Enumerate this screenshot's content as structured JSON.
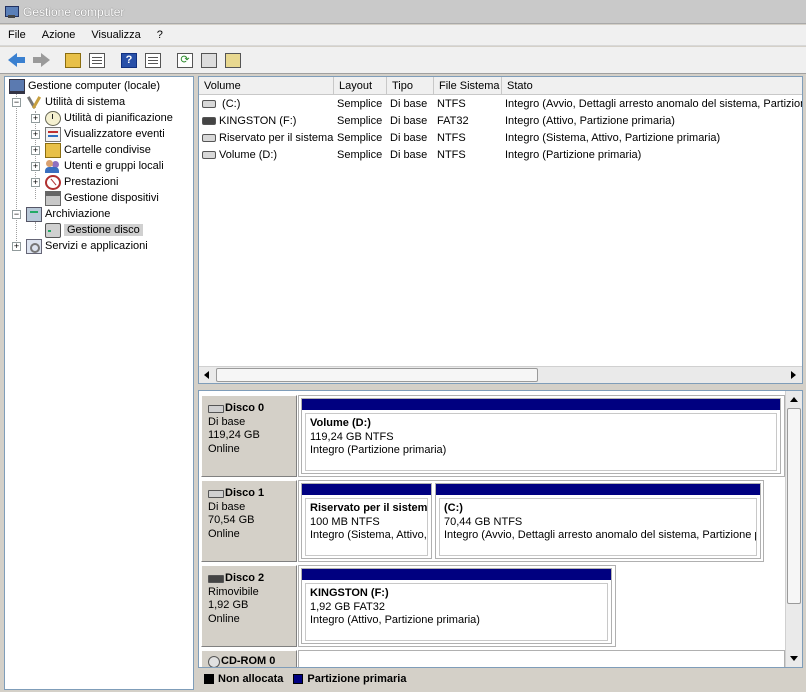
{
  "window": {
    "title": "Gestione computer"
  },
  "menu": [
    "File",
    "Azione",
    "Visualizza",
    "?"
  ],
  "tree": {
    "root": "Gestione computer (locale)",
    "system_tools": "Utilità di sistema",
    "task_scheduler": "Utilità di pianificazione",
    "event_viewer": "Visualizzatore eventi",
    "shared_folders": "Cartelle condivise",
    "local_users": "Utenti e gruppi locali",
    "performance": "Prestazioni",
    "device_manager": "Gestione dispositivi",
    "storage": "Archiviazione",
    "disk_management": "Gestione disco",
    "services_apps": "Servizi e applicazioni"
  },
  "volume_list": {
    "columns": [
      "Volume",
      "Layout",
      "Tipo",
      "File Sistema",
      "Stato"
    ],
    "rows": [
      {
        "volume": " (C:)",
        "layout": "Semplice",
        "tipo": "Di base",
        "fs": "NTFS",
        "stato": "Integro (Avvio, Dettagli arresto anomalo del sistema, Partizione primaria)",
        "icon": "drive-icon"
      },
      {
        "volume": "KINGSTON (F:)",
        "layout": "Semplice",
        "tipo": "Di base",
        "fs": "FAT32",
        "stato": "Integro (Attivo, Partizione primaria)",
        "icon": "usb-drive-icon"
      },
      {
        "volume": "Riservato per il sistema",
        "layout": "Semplice",
        "tipo": "Di base",
        "fs": "NTFS",
        "stato": "Integro (Sistema, Attivo, Partizione primaria)",
        "icon": "drive-icon"
      },
      {
        "volume": "Volume (D:)",
        "layout": "Semplice",
        "tipo": "Di base",
        "fs": "NTFS",
        "stato": "Integro (Partizione primaria)",
        "icon": "drive-icon"
      }
    ]
  },
  "disks": [
    {
      "name": "Disco 0",
      "type": "Di base",
      "size": "119,24 GB",
      "status": "Online",
      "partitions": [
        {
          "name": "Volume  (D:)",
          "size": "119,24 GB NTFS",
          "status": "Integro (Partizione primaria)"
        }
      ]
    },
    {
      "name": "Disco 1",
      "type": "Di base",
      "size": "70,54 GB",
      "status": "Online",
      "partitions": [
        {
          "name": "Riservato per il sistema",
          "size": "100 MB NTFS",
          "status": "Integro (Sistema, Attivo, Partizione primaria)"
        },
        {
          "name": "  (C:)",
          "size": "70,44 GB NTFS",
          "status": "Integro (Avvio, Dettagli arresto anomalo del sistema, Partizione primaria)"
        }
      ]
    },
    {
      "name": "Disco 2",
      "type": "Rimovibile",
      "size": "1,92 GB",
      "status": "Online",
      "partitions": [
        {
          "name": "KINGSTON  (F:)",
          "size": "1,92 GB FAT32",
          "status": "Integro (Attivo, Partizione primaria)"
        }
      ]
    },
    {
      "name": "CD-ROM 0"
    }
  ],
  "legend": {
    "unallocated": {
      "label": "Non allocata",
      "color": "#000000"
    },
    "primary": {
      "label": "Partizione primaria",
      "color": "#000080"
    }
  }
}
